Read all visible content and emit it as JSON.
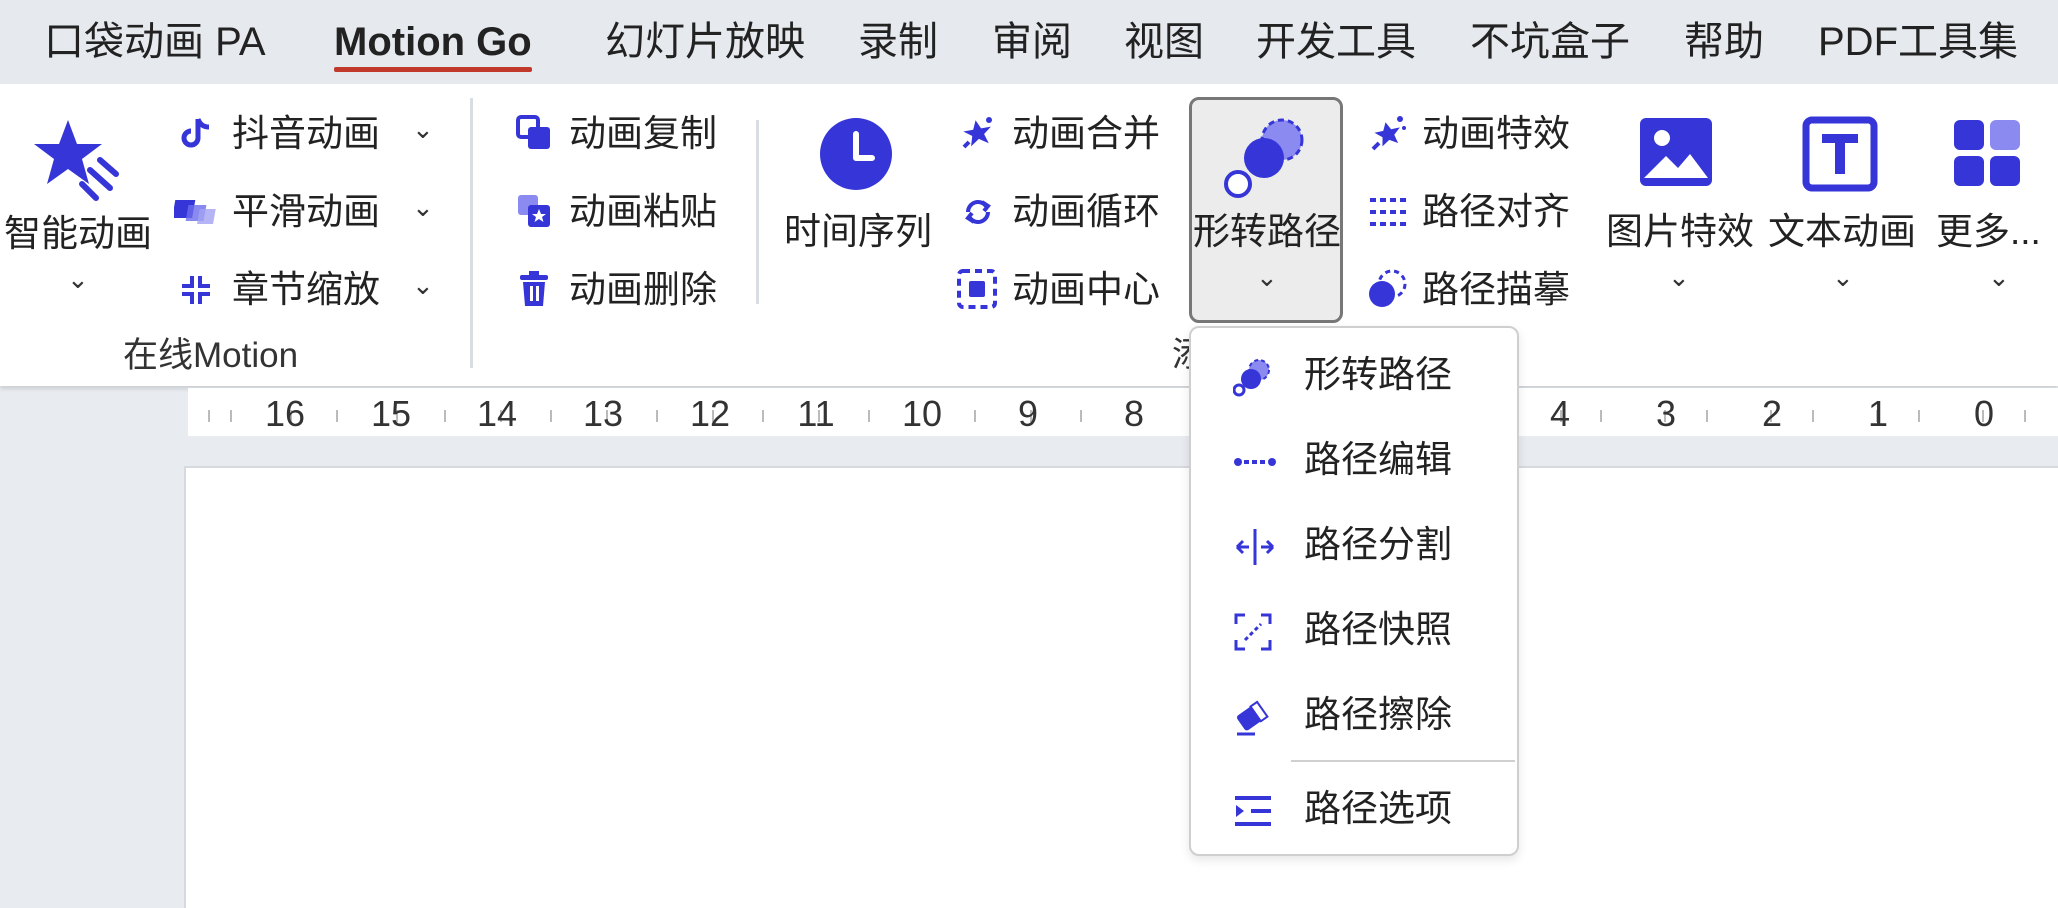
{
  "menu_tabs": [
    "口袋动画 PA",
    "Motion Go",
    "幻灯片放映",
    "录制",
    "审阅",
    "视图",
    "开发工具",
    "不坑盒子",
    "帮助",
    "PDF工具集"
  ],
  "active_tab": "Motion Go",
  "accent_color": "#3b3bdb",
  "ribbon": {
    "smart_animation": "智能动画",
    "douyin_animation": "抖音动画",
    "smooth_animation": "平滑动画",
    "chapter_zoom": "章节缩放",
    "group_online_motion": "在线Motion",
    "anim_copy": "动画复制",
    "anim_paste": "动画粘贴",
    "anim_delete": "动画删除",
    "timeline": "时间序列",
    "anim_merge": "动画合并",
    "anim_loop": "动画循环",
    "anim_center": "动画中心",
    "morph_path": "形转路径",
    "anim_effects": "动画特效",
    "path_align": "路径对齐",
    "path_trace": "路径描摹",
    "image_effects": "图片特效",
    "text_animation": "文本动画",
    "more": "更多...",
    "group_partial": "添"
  },
  "ruler_numbers": [
    "16",
    "15",
    "14",
    "13",
    "12",
    "11",
    "10",
    "9",
    "8",
    "4",
    "3",
    "2",
    "1",
    "0"
  ],
  "dropdown": {
    "items": [
      {
        "label": "形转路径",
        "icon": "morph-path-icon"
      },
      {
        "label": "路径编辑",
        "icon": "path-edit-icon"
      },
      {
        "label": "路径分割",
        "icon": "path-split-icon"
      },
      {
        "label": "路径快照",
        "icon": "path-snapshot-icon"
      },
      {
        "label": "路径擦除",
        "icon": "path-erase-icon"
      },
      {
        "label": "路径选项",
        "icon": "path-options-icon"
      }
    ]
  }
}
